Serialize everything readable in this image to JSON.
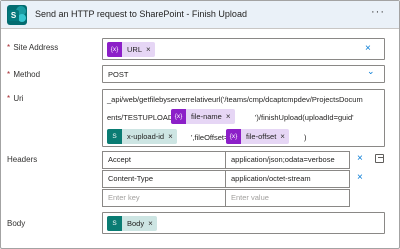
{
  "header": {
    "logo_letter": "S",
    "title": "Send an HTTP request to SharePoint - Finish Upload",
    "more_label": "···"
  },
  "site_address": {
    "label": "Site Address",
    "required": "*",
    "token": {
      "icon": "{x}",
      "label": "URL",
      "remove": "×"
    },
    "clear": "×"
  },
  "method": {
    "label": "Method",
    "required": "*",
    "value": "POST",
    "chevron": "⌄"
  },
  "uri": {
    "label": "Uri",
    "required": "*",
    "line1": "_api/web/getfilebyserverrelativeurl('/teams/cmp/dcaptcmpdev/ProjectsDocum",
    "line2_prefix": "ents/TESTUPLOAD/",
    "line2_suffix": "')/finishUpload(uploadId=guid'",
    "line3_mid": "',fileOffset=",
    "line3_end": ")",
    "token_file_name": {
      "icon": "{x}",
      "label": "file-name",
      "remove": "×"
    },
    "token_upload_id": {
      "icon": "S",
      "label": "x-upload-id",
      "remove": "×"
    },
    "token_file_offset": {
      "icon": "{x}",
      "label": "file-offset",
      "remove": "×"
    }
  },
  "headers": {
    "label": "Headers",
    "rows": [
      {
        "key": "Accept",
        "value": "application/json;odata=verbose",
        "remove": "×"
      },
      {
        "key": "Content-Type",
        "value": "application/octet-stream",
        "remove": "×"
      }
    ],
    "key_placeholder": "Enter key",
    "value_placeholder": "Enter value"
  },
  "body": {
    "label": "Body",
    "token": {
      "icon": "S",
      "label": "Body",
      "remove": "×"
    }
  },
  "colors": {
    "header_bg": "#eaf1f8",
    "expression_token": "#e6d6f5",
    "expression_icon": "#8c1fc8",
    "sharepoint_token": "#cde5e3",
    "sharepoint_icon": "#0a7c73",
    "accent": "#0078d4",
    "required": "#a4262c"
  }
}
